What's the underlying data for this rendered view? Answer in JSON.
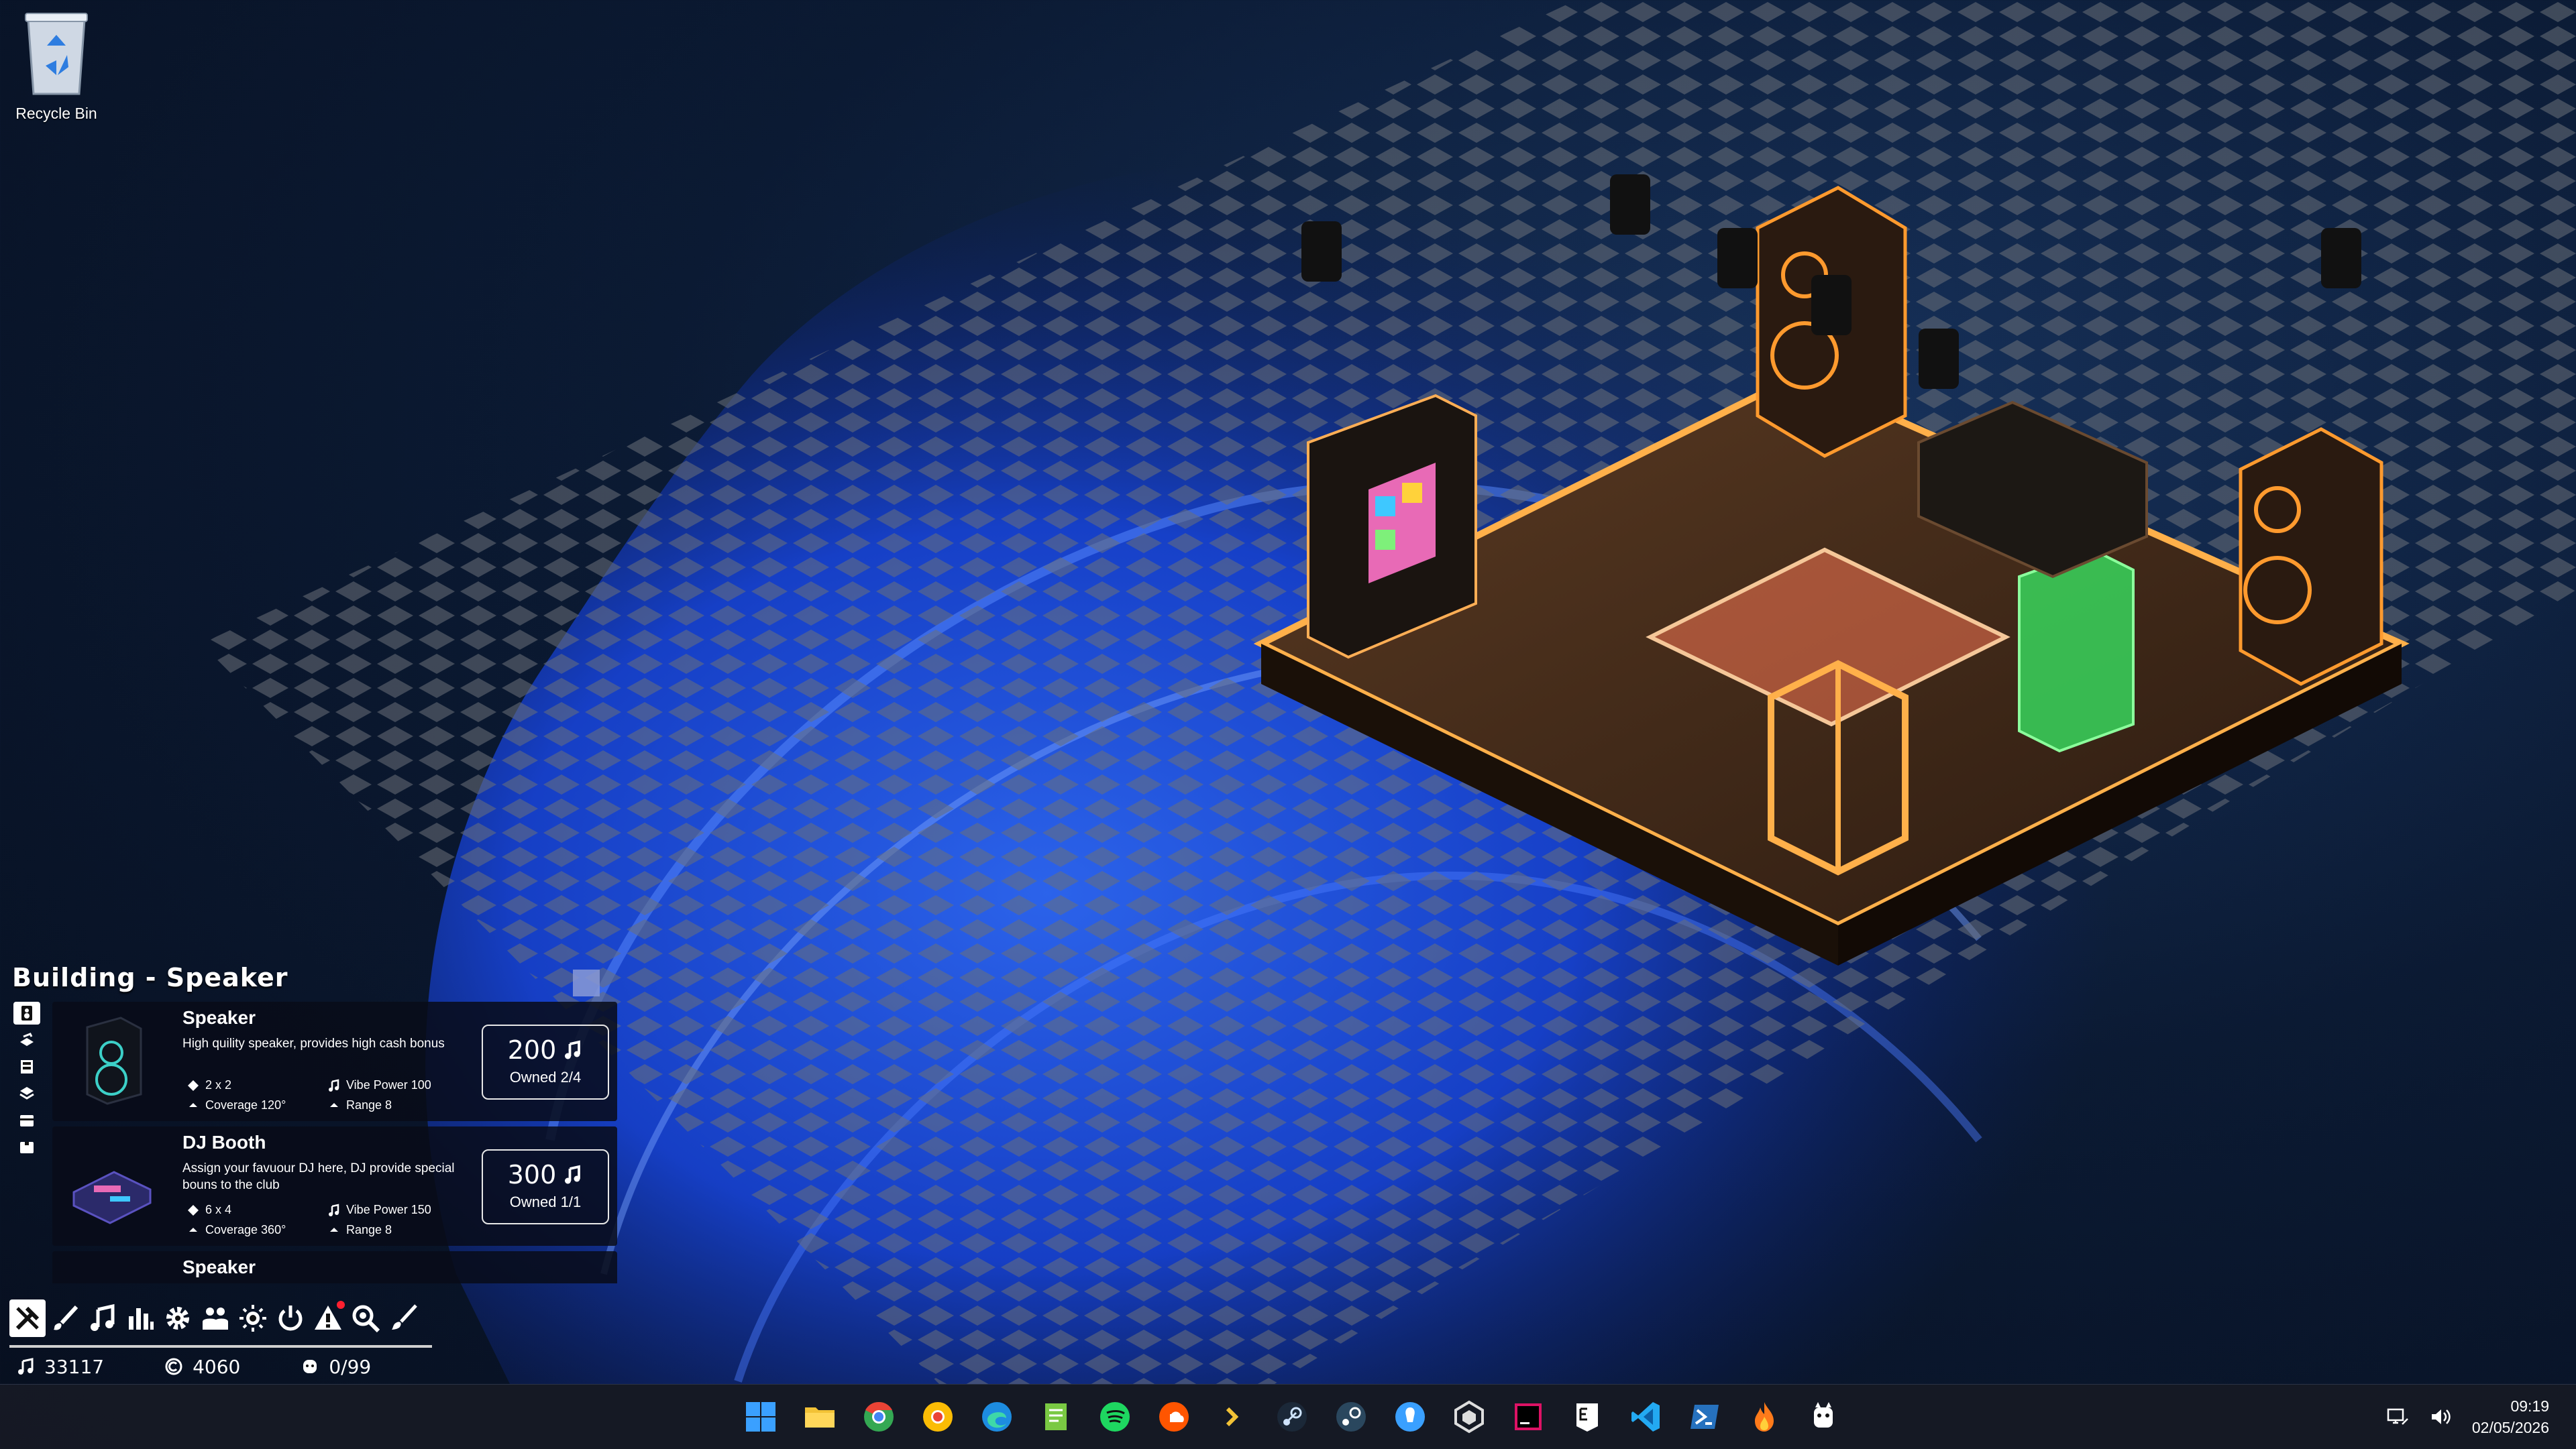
{
  "desktop": {
    "recycle_bin_label": "Recycle Bin"
  },
  "panel": {
    "title": "Building - Speaker",
    "categories": [
      "speaker-icon",
      "dj-booth-icon",
      "vending-machine-icon",
      "layers-icon",
      "box-icon",
      "crate-icon"
    ],
    "cards": [
      {
        "name": "Speaker",
        "description": "High quility speaker, provides high cash bonus",
        "size": "2 x 2",
        "coverage": "Coverage 120°",
        "vibe": "Vibe Power 100",
        "range": "Range 8",
        "price": "200",
        "owned": "Owned 2/4"
      },
      {
        "name": "DJ Booth",
        "description": "Assign your favuour DJ here, DJ provide special bouns to the club",
        "size": "6 x 4",
        "coverage": "Coverage 360°",
        "vibe": "Vibe Power 150",
        "range": "Range 8",
        "price": "300",
        "owned": "Owned 1/1"
      },
      {
        "name": "Speaker",
        "description": "",
        "size": "",
        "coverage": "",
        "vibe": "",
        "range": "",
        "price": "",
        "owned": ""
      }
    ]
  },
  "toolbar": {
    "tools": [
      "build-hammer-icon",
      "paint-brush-icon",
      "music-note-icon",
      "stats-bars-icon",
      "settings-gear-icon",
      "staff-people-icon",
      "lighting-icon",
      "power-icon",
      "alert-icon",
      "inspect-icon",
      "paint-icon"
    ],
    "alert_has_badge": true
  },
  "stats": {
    "music": "33117",
    "coins": "4060",
    "visitors": "0/99"
  },
  "taskbar": {
    "apps": [
      "windows-start-icon",
      "file-explorer-icon",
      "chrome-icon",
      "chrome-beta-icon",
      "edge-icon",
      "notepad-icon",
      "spotify-icon",
      "soundcloud-icon",
      "prompt-icon",
      "steam-icon",
      "steam-alt-icon",
      "bulb-app-icon",
      "unity-icon",
      "rider-icon",
      "epic-games-icon",
      "vscode-icon",
      "powershell-icon",
      "fire-app-icon",
      "game-character-icon"
    ],
    "time": "09:19",
    "date": "02/05/2026"
  },
  "colors": {
    "accent_orange": "#ff9a2e",
    "neon_green": "#38e060",
    "wallpaper_blue": "#1a4cff"
  }
}
